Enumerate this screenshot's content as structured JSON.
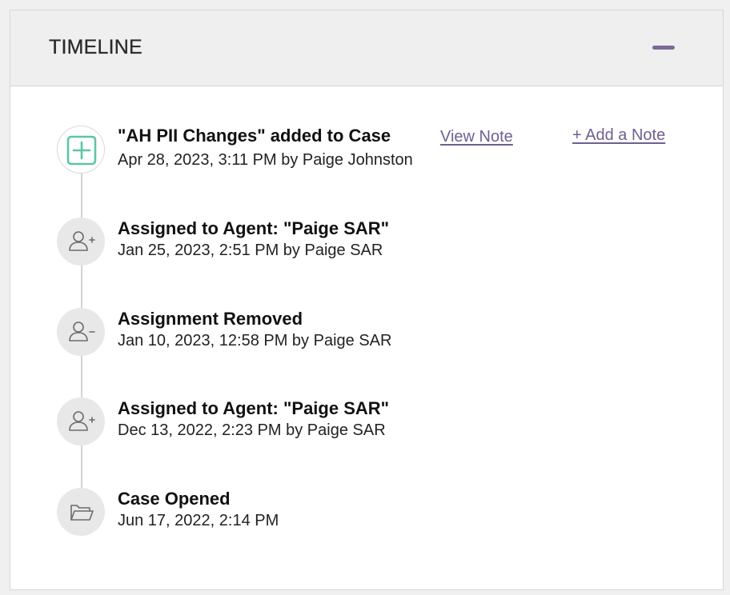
{
  "header": {
    "title": "TIMELINE",
    "collapse_icon": "minus-icon"
  },
  "colors": {
    "accent": "#7a6a9a",
    "link": "#6f5f93",
    "note_icon": "#5cc6a3"
  },
  "events": [
    {
      "title": "\"AH PII Changes\" added to Case",
      "meta": "Apr 28, 2023, 3:11 PM by Paige Johnston",
      "icon": "note-add-icon",
      "view_note_label": "View Note",
      "add_note_label": "+ Add a Note"
    },
    {
      "title": "Assigned to Agent: \"Paige SAR\"",
      "meta": "Jan 25, 2023, 2:51 PM by Paige SAR",
      "icon": "user-add-icon"
    },
    {
      "title": "Assignment Removed",
      "meta": "Jan 10, 2023, 12:58 PM by Paige SAR",
      "icon": "user-remove-icon"
    },
    {
      "title": "Assigned to Agent: \"Paige SAR\"",
      "meta": "Dec 13, 2022, 2:23 PM by Paige SAR",
      "icon": "user-add-icon"
    },
    {
      "title": "Case Opened",
      "meta": "Jun 17, 2022, 2:14 PM",
      "icon": "folder-icon"
    }
  ]
}
